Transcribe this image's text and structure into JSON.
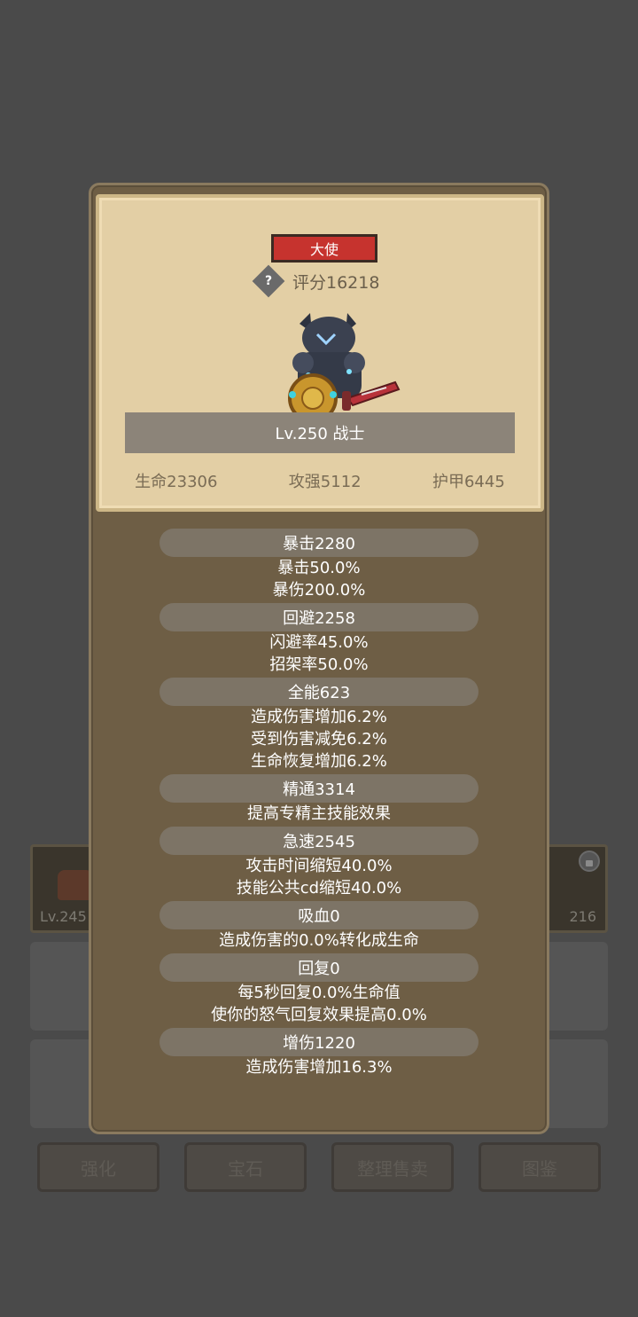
{
  "background": {
    "left_slot_level": "Lv.245",
    "right_slot_level": "216",
    "buttons": [
      "强化",
      "宝石",
      "整理售卖",
      "图鉴"
    ]
  },
  "card": {
    "rank": "大使",
    "score": "评分16218",
    "level_class": "Lv.250 战士",
    "stats": [
      "生命23306",
      "攻强5112",
      "护甲6445"
    ],
    "groups": [
      {
        "title": "暴击2280",
        "lines": [
          "暴击50.0%",
          "暴伤200.0%"
        ]
      },
      {
        "title": "回避2258",
        "lines": [
          "闪避率45.0%",
          "招架率50.0%"
        ]
      },
      {
        "title": "全能623",
        "lines": [
          "造成伤害增加6.2%",
          "受到伤害减免6.2%",
          "生命恢复增加6.2%"
        ]
      },
      {
        "title": "精通3314",
        "lines": [
          "提高专精主技能效果"
        ]
      },
      {
        "title": "急速2545",
        "lines": [
          "攻击时间缩短40.0%",
          "技能公共cd缩短40.0%"
        ]
      },
      {
        "title": "吸血0",
        "lines": [
          "造成伤害的0.0%转化成生命"
        ]
      },
      {
        "title": "回复0",
        "lines": [
          "每5秒回复0.0%生命值",
          "使你的怒气回复效果提高0.0%"
        ]
      },
      {
        "title": "增伤1220",
        "lines": [
          "造成伤害增加16.3%"
        ]
      }
    ]
  },
  "icons": {
    "help": "help-icon",
    "hero": "knight-hero-icon",
    "lock": "lock-icon"
  }
}
